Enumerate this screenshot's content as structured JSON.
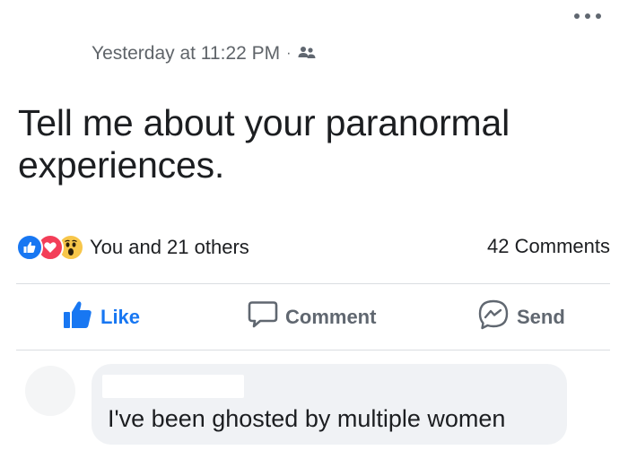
{
  "post": {
    "timestamp": "Yesterday at 11:22 PM",
    "separator": "·",
    "audience_icon": "friends-icon",
    "text": "Tell me about your paranormal experiences."
  },
  "more_icon": "more-horizontal-icon",
  "reactions": {
    "icons": [
      "like-reaction",
      "love-reaction",
      "wow-reaction"
    ],
    "summary": "You and 21 others",
    "comments_count": "42 Comments"
  },
  "actions": {
    "like_label": "Like",
    "comment_label": "Comment",
    "send_label": "Send"
  },
  "comment": {
    "text": "I've been ghosted by multiple women"
  },
  "colors": {
    "accent": "#1877f2",
    "love": "#f33e58",
    "wow": "#f7c64a",
    "muted_text": "#606770",
    "bubble": "#f0f2f5"
  }
}
